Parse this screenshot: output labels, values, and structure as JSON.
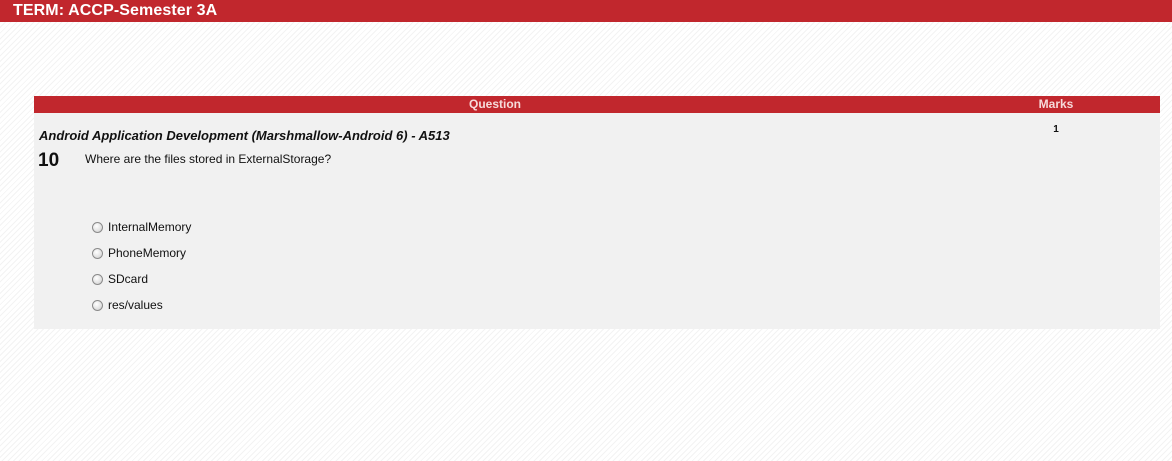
{
  "header": {
    "term_title": "TERM: ACCP-Semester 3A"
  },
  "table": {
    "col_question": "Question",
    "col_marks": "Marks"
  },
  "question": {
    "course": "Android Application Development (Marshmallow-Android 6) - A513",
    "number": "10",
    "text": "Where are the files stored in ExternalStorage?",
    "marks": "1",
    "options": [
      {
        "label": "InternalMemory"
      },
      {
        "label": "PhoneMemory"
      },
      {
        "label": "SDcard"
      },
      {
        "label": "res/values"
      }
    ]
  },
  "colors": {
    "accent": "#c1272d",
    "panel": "#f1f1f1"
  },
  "icons": {
    "radio": "radio-unchecked-icon"
  }
}
